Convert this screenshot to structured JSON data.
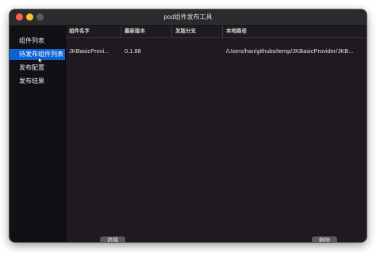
{
  "window": {
    "title": "pod组件发布工具"
  },
  "sidebar": {
    "items": [
      {
        "label": "组件列表"
      },
      {
        "label": "待发布组件列表"
      },
      {
        "label": "发布配置"
      },
      {
        "label": "发布结果"
      }
    ],
    "selected_index": 1
  },
  "table": {
    "columns": [
      "组件名字",
      "最新版本",
      "发版分支",
      "本地路径"
    ],
    "rows": [
      [
        "JKBasicProvi...",
        "0.1.88",
        "",
        "/Users/han/githubs/temp/JKBasicProvider/JKB..."
      ]
    ]
  },
  "buttons": {
    "select_label": "选择",
    "delete_label": "删除"
  },
  "colors": {
    "accent": "#0b63d3",
    "close": "#fe5f57",
    "minimize": "#febc2e",
    "maximize_disabled": "#5c5b5e"
  }
}
